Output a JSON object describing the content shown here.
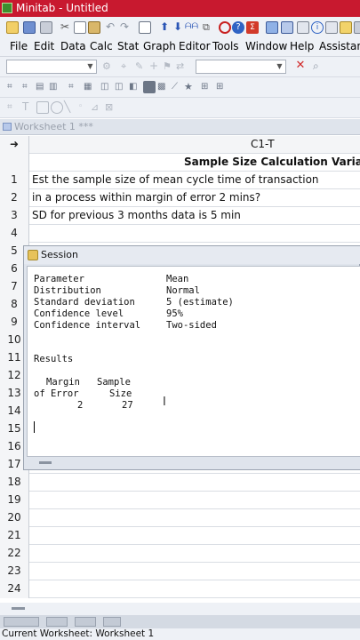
{
  "window": {
    "title": "Minitab - Untitled"
  },
  "menubar": {
    "items": [
      "File",
      "Edit",
      "Data",
      "Calc",
      "Stat",
      "Graph",
      "Editor",
      "Tools",
      "Window",
      "Help",
      "Assistant"
    ]
  },
  "worksheet": {
    "title": "Worksheet 1 ***",
    "column_id": "C1-T",
    "column_name": "Sample Size Calculation Variabl",
    "rows": [
      {
        "num": "1",
        "text": "Est the sample size of mean cycle time of transaction"
      },
      {
        "num": "2",
        "text": "in a process within margin of error 2 mins?"
      },
      {
        "num": "3",
        "text": "SD for previous 3 months data is 5 min"
      },
      {
        "num": "4",
        "text": ""
      },
      {
        "num": "5",
        "text": ""
      },
      {
        "num": "6",
        "text": ""
      },
      {
        "num": "7",
        "text": ""
      },
      {
        "num": "8",
        "text": ""
      },
      {
        "num": "9",
        "text": ""
      },
      {
        "num": "10",
        "text": ""
      },
      {
        "num": "11",
        "text": ""
      },
      {
        "num": "12",
        "text": ""
      },
      {
        "num": "13",
        "text": ""
      },
      {
        "num": "14",
        "text": ""
      },
      {
        "num": "15",
        "text": ""
      },
      {
        "num": "16",
        "text": ""
      },
      {
        "num": "17",
        "text": ""
      },
      {
        "num": "18",
        "text": ""
      },
      {
        "num": "19",
        "text": ""
      },
      {
        "num": "20",
        "text": ""
      },
      {
        "num": "21",
        "text": ""
      },
      {
        "num": "22",
        "text": ""
      },
      {
        "num": "23",
        "text": ""
      },
      {
        "num": "24",
        "text": ""
      }
    ]
  },
  "session": {
    "title": "Session",
    "params": [
      {
        "label": "Parameter",
        "value": "Mean"
      },
      {
        "label": "Distribution",
        "value": "Normal"
      },
      {
        "label": "Standard deviation",
        "value": "5 (estimate)"
      },
      {
        "label": "Confidence level",
        "value": "95%"
      },
      {
        "label": "Confidence interval",
        "value": "Two-sided"
      }
    ],
    "results_heading": "Results",
    "col1_header_1": "Margin",
    "col1_header_2": "of Error",
    "col2_header_1": "Sample",
    "col2_header_2": "Size",
    "margin_value": "2",
    "size_value": "27"
  },
  "status": {
    "text": "Current Worksheet: Worksheet 1"
  }
}
